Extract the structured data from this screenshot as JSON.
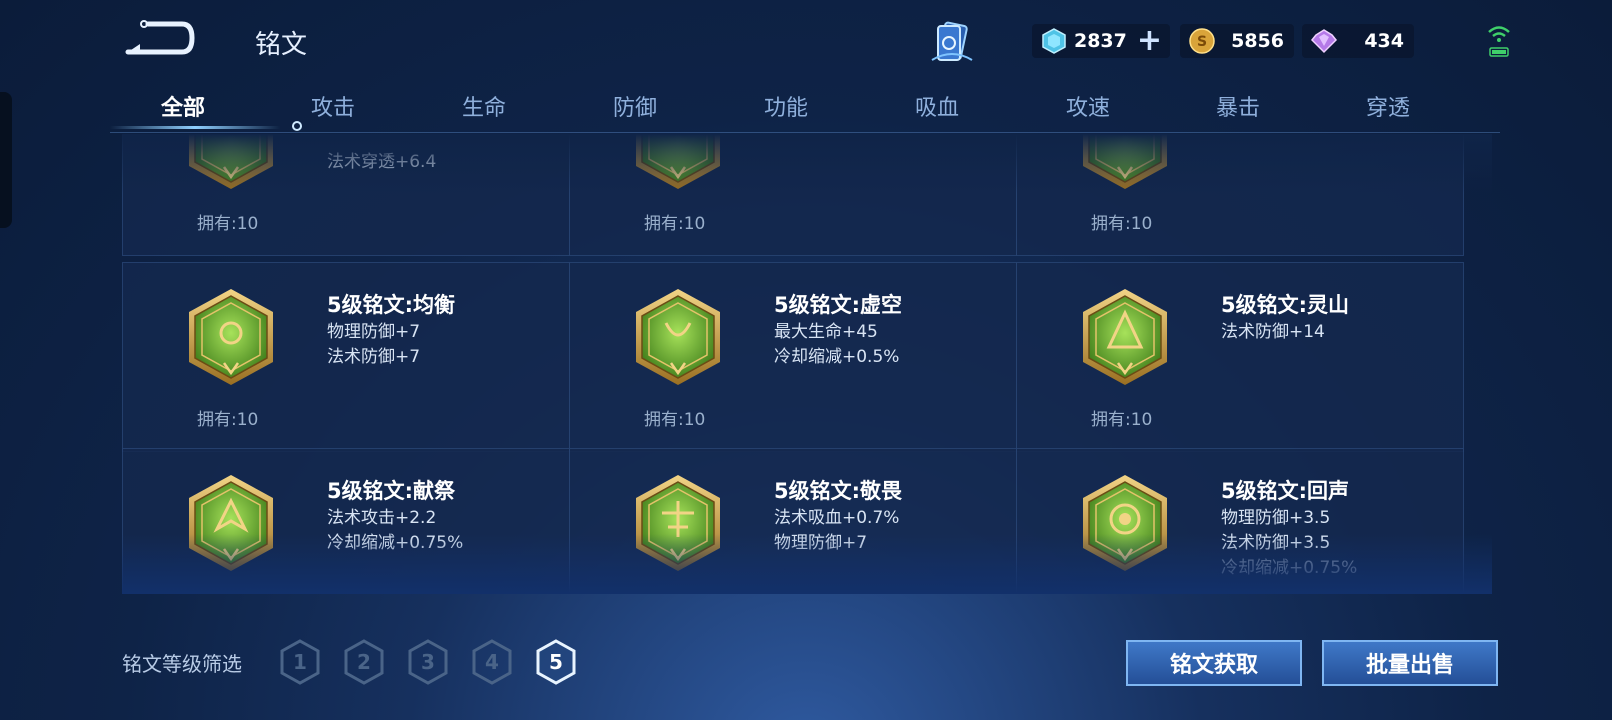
{
  "header": {
    "title": "铭文"
  },
  "currency": [
    {
      "name": "diamond",
      "icon": "diamond-icon",
      "value": "2837",
      "addable": true
    },
    {
      "name": "coin",
      "icon": "coin-icon",
      "value": "5856",
      "addable": false
    },
    {
      "name": "gem",
      "icon": "gem-icon",
      "value": "434",
      "addable": false
    }
  ],
  "tabs": [
    "全部",
    "攻击",
    "生命",
    "防御",
    "功能",
    "吸血",
    "攻速",
    "暴击",
    "穿透"
  ],
  "active_tab": "全部",
  "runes": [
    {
      "name": "",
      "attrs": [
        "法术穿透+6.4"
      ],
      "owned": "拥有:10",
      "partial": true
    },
    {
      "name": "",
      "attrs": [],
      "owned": "拥有:10",
      "partial": true
    },
    {
      "name": "",
      "attrs": [],
      "owned": "拥有:10",
      "partial": true
    },
    {
      "name": "5级铭文:均衡",
      "attrs": [
        "物理防御+7",
        "法术防御+7"
      ],
      "owned": "拥有:10"
    },
    {
      "name": "5级铭文:虚空",
      "attrs": [
        "最大生命+45",
        "冷却缩减+0.5%"
      ],
      "owned": "拥有:10"
    },
    {
      "name": "5级铭文:灵山",
      "attrs": [
        "法术防御+14"
      ],
      "owned": "拥有:10"
    },
    {
      "name": "5级铭文:献祭",
      "attrs": [
        "法术攻击+2.2",
        "冷却缩减+0.75%"
      ],
      "owned": ""
    },
    {
      "name": "5级铭文:敬畏",
      "attrs": [
        "法术吸血+0.7%",
        "物理防御+7"
      ],
      "owned": ""
    },
    {
      "name": "5级铭文:回声",
      "attrs": [
        "物理防御+3.5",
        "法术防御+3.5",
        "冷却缩减+0.75%"
      ],
      "owned": ""
    }
  ],
  "filter": {
    "label": "铭文等级筛选",
    "levels": [
      "1",
      "2",
      "3",
      "4",
      "5"
    ],
    "selected": "5"
  },
  "buttons": {
    "acquire": "铭文获取",
    "bulk_sell": "批量出售"
  },
  "colors": {
    "accent": "#8fd0ff",
    "rune_green": "#5fa62c",
    "rune_gold": "#c8a24a",
    "button": "#3f78c8"
  }
}
